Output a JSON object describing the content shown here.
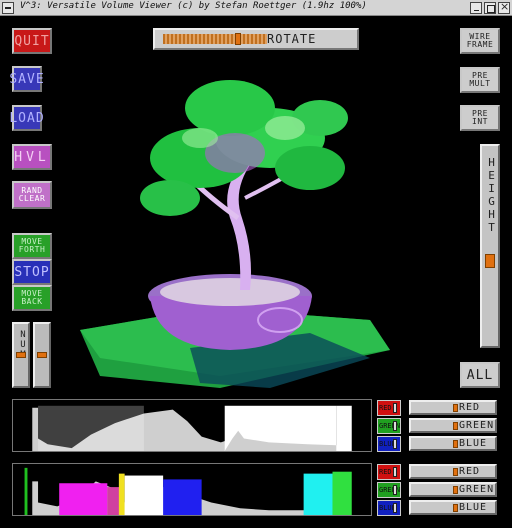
{
  "window": {
    "title": "V^3: Versatile Volume Viewer (c) by Stefan Roettger (1.9hz 100%)"
  },
  "left_buttons": {
    "quit": "QUIT",
    "save": "SAVE",
    "load": "LOAD",
    "hvl": "HVL",
    "rand_clear": "RAND\nCLEAR",
    "move_forth": "MOVE\nFORTH",
    "stop": "STOP",
    "move_back": "MOVE\nBACK",
    "num": "NUM"
  },
  "top": {
    "rotate": "ROTATE"
  },
  "right_buttons": {
    "wire_frame": "WIRE\nFRAME",
    "pre_mult": "PRE\nMULT",
    "pre_int": "PRE\nINT",
    "height": "HEIGHT",
    "all": "ALL"
  },
  "channels_top": [
    {
      "indicator": "RED",
      "label": "RED",
      "color": "#d01010"
    },
    {
      "indicator": "GREEN",
      "label": "GREEN",
      "color": "#20a020"
    },
    {
      "indicator": "BLUE",
      "label": "BLUE",
      "color": "#1020c0"
    }
  ],
  "channels_bottom": [
    {
      "indicator": "RED",
      "label": "RED",
      "color": "#d01010"
    },
    {
      "indicator": "GREEN",
      "label": "GREEN",
      "color": "#20a020"
    },
    {
      "indicator": "BLUE",
      "label": "BLUE",
      "color": "#1020c0"
    }
  ],
  "colors": {
    "quit_bg": "#c81818",
    "save_bg": "#3838b8",
    "hvl_bg": "#b850c0",
    "rand_bg": "#c070c8",
    "green_bg": "#28a028",
    "stop_bg": "#2830b8",
    "slider_knob": "#e07010"
  }
}
